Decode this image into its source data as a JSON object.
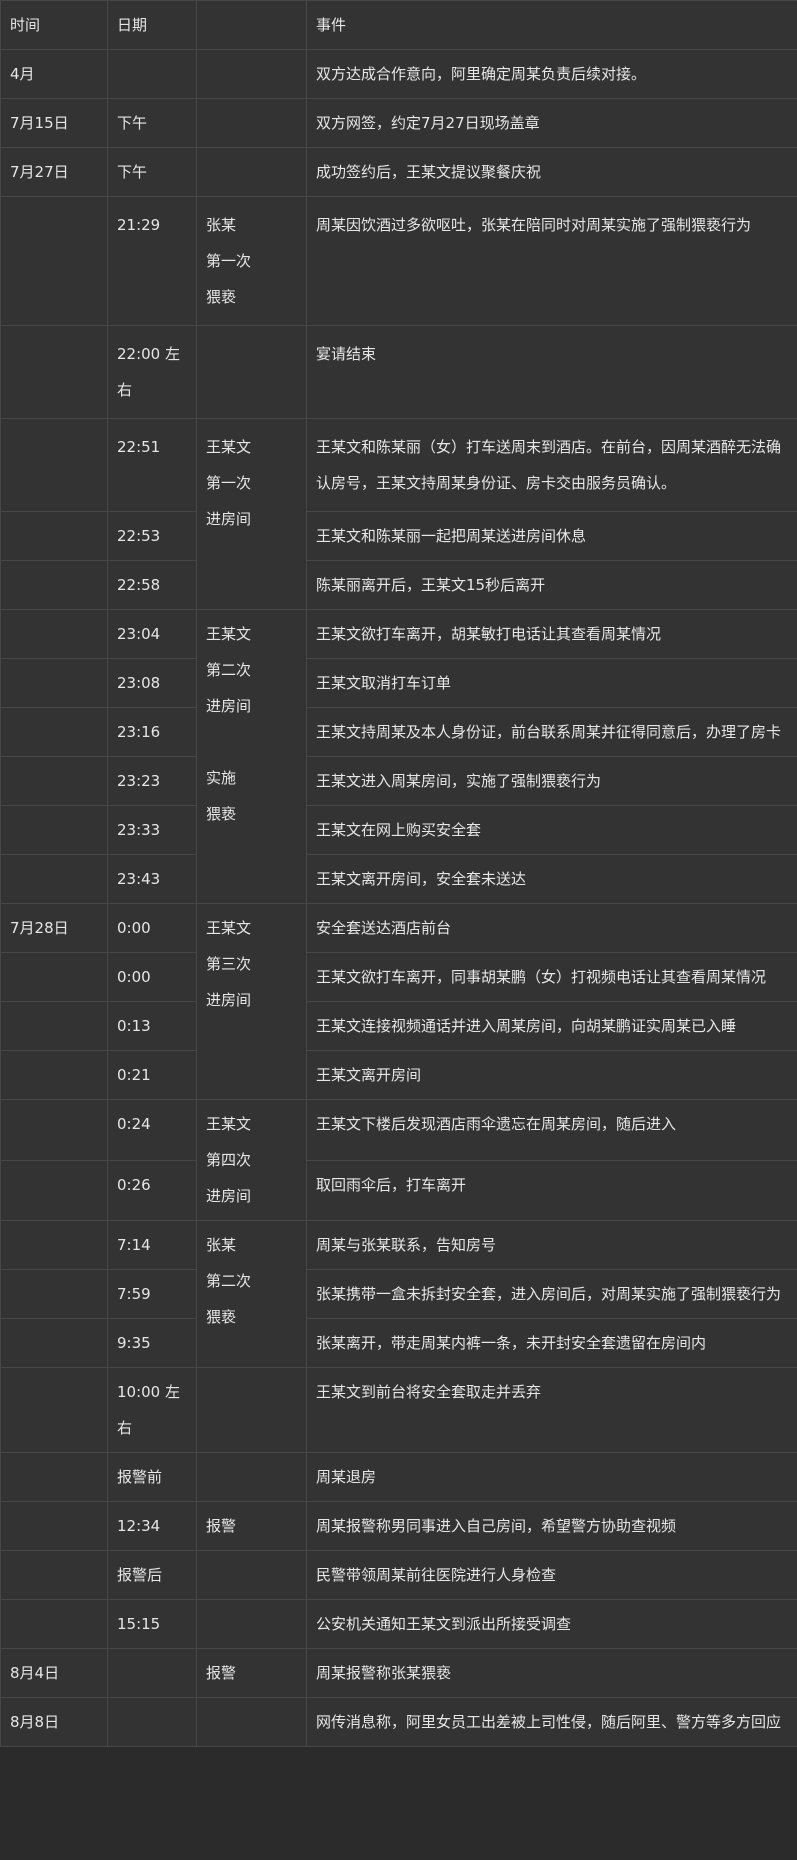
{
  "header": {
    "time": "时间",
    "date": "日期",
    "col3": "",
    "event": "事件"
  },
  "rows": [
    {
      "time": "4月",
      "date": "",
      "group": "",
      "event": "双方达成合作意向，阿里确定周某负责后续对接。"
    },
    {
      "time": "7月15日",
      "date": "下午",
      "group": "",
      "event": "双方网签，约定7月27日现场盖章"
    },
    {
      "time": "7月27日",
      "date": "下午",
      "group": "",
      "event": "成功签约后，王某文提议聚餐庆祝"
    },
    {
      "time": "",
      "date": "21:29",
      "group": "张某\n第一次\n猥亵",
      "event": "周某因饮酒过多欲呕吐，张某在陪同时对周某实施了强制猥亵行为"
    },
    {
      "time": "",
      "date": "22:00 左右",
      "group": "",
      "event": "宴请结束"
    },
    {
      "time": "",
      "date": "22:51",
      "group": "王某文\n第一次\n进房间",
      "event": "王某文和陈某丽（女）打车送周末到酒店。在前台，因周某酒醉无法确认房号，王某文持周某身份证、房卡交由服务员确认。"
    },
    {
      "time": "",
      "date": "22:53",
      "group": "",
      "event": "王某文和陈某丽一起把周某送进房间休息"
    },
    {
      "time": "",
      "date": "22:58",
      "group": "",
      "event": "陈某丽离开后，王某文15秒后离开"
    },
    {
      "time": "",
      "date": "23:04",
      "group": "王某文\n第二次\n进房间\n\n实施\n猥亵",
      "event": "王某文欲打车离开，胡某敏打电话让其查看周某情况"
    },
    {
      "time": "",
      "date": "23:08",
      "group": "",
      "event": "王某文取消打车订单"
    },
    {
      "time": "",
      "date": "23:16",
      "group": "",
      "event": "王某文持周某及本人身份证，前台联系周某并征得同意后，办理了房卡"
    },
    {
      "time": "",
      "date": "23:23",
      "group": "",
      "event": "王某文进入周某房间，实施了强制猥亵行为"
    },
    {
      "time": "",
      "date": "23:33",
      "group": "",
      "event": "王某文在网上购买安全套"
    },
    {
      "time": "",
      "date": "23:43",
      "group": "",
      "event": "王某文离开房间，安全套未送达"
    },
    {
      "time": "7月28日",
      "date": "0:00",
      "group": "王某文\n第三次\n进房间",
      "event": "安全套送达酒店前台"
    },
    {
      "time": "",
      "date": "0:00",
      "group": "",
      "event": "王某文欲打车离开，同事胡某鹏（女）打视频电话让其查看周某情况"
    },
    {
      "time": "",
      "date": "0:13",
      "group": "",
      "event": "王某文连接视频通话并进入周某房间，向胡某鹏证实周某已入睡"
    },
    {
      "time": "",
      "date": "0:21",
      "group": "",
      "event": "王某文离开房间"
    },
    {
      "time": "",
      "date": "0:24",
      "group": "王某文\n第四次\n进房间",
      "event": "王某文下楼后发现酒店雨伞遗忘在周某房间，随后进入"
    },
    {
      "time": "",
      "date": "0:26",
      "group": "",
      "event": "取回雨伞后，打车离开"
    },
    {
      "time": "",
      "date": "7:14",
      "group": "张某\n第二次\n猥亵",
      "event": "周某与张某联系，告知房号"
    },
    {
      "time": "",
      "date": "7:59",
      "group": "",
      "event": "张某携带一盒未拆封安全套，进入房间后，对周某实施了强制猥亵行为"
    },
    {
      "time": "",
      "date": "9:35",
      "group": "",
      "event": "张某离开，带走周某内裤一条，未开封安全套遗留在房间内"
    },
    {
      "time": "",
      "date": "10:00 左右",
      "group": "",
      "event": "王某文到前台将安全套取走并丢弃"
    },
    {
      "time": "",
      "date": "报警前",
      "group": "",
      "event": "周某退房"
    },
    {
      "time": "",
      "date": "12:34",
      "group": "报警",
      "event": "周某报警称男同事进入自己房间，希望警方协助查视频"
    },
    {
      "time": "",
      "date": "报警后",
      "group": "",
      "event": "民警带领周某前往医院进行人身检查"
    },
    {
      "time": "",
      "date": "15:15",
      "group": "",
      "event": "公安机关通知王某文到派出所接受调查"
    },
    {
      "time": "8月4日",
      "date": "",
      "group": "报警",
      "event": "周某报警称张某猥亵"
    },
    {
      "time": "8月8日",
      "date": "",
      "group": "",
      "event": "网传消息称，阿里女员工出差被上司性侵，随后阿里、警方等多方回应"
    }
  ]
}
